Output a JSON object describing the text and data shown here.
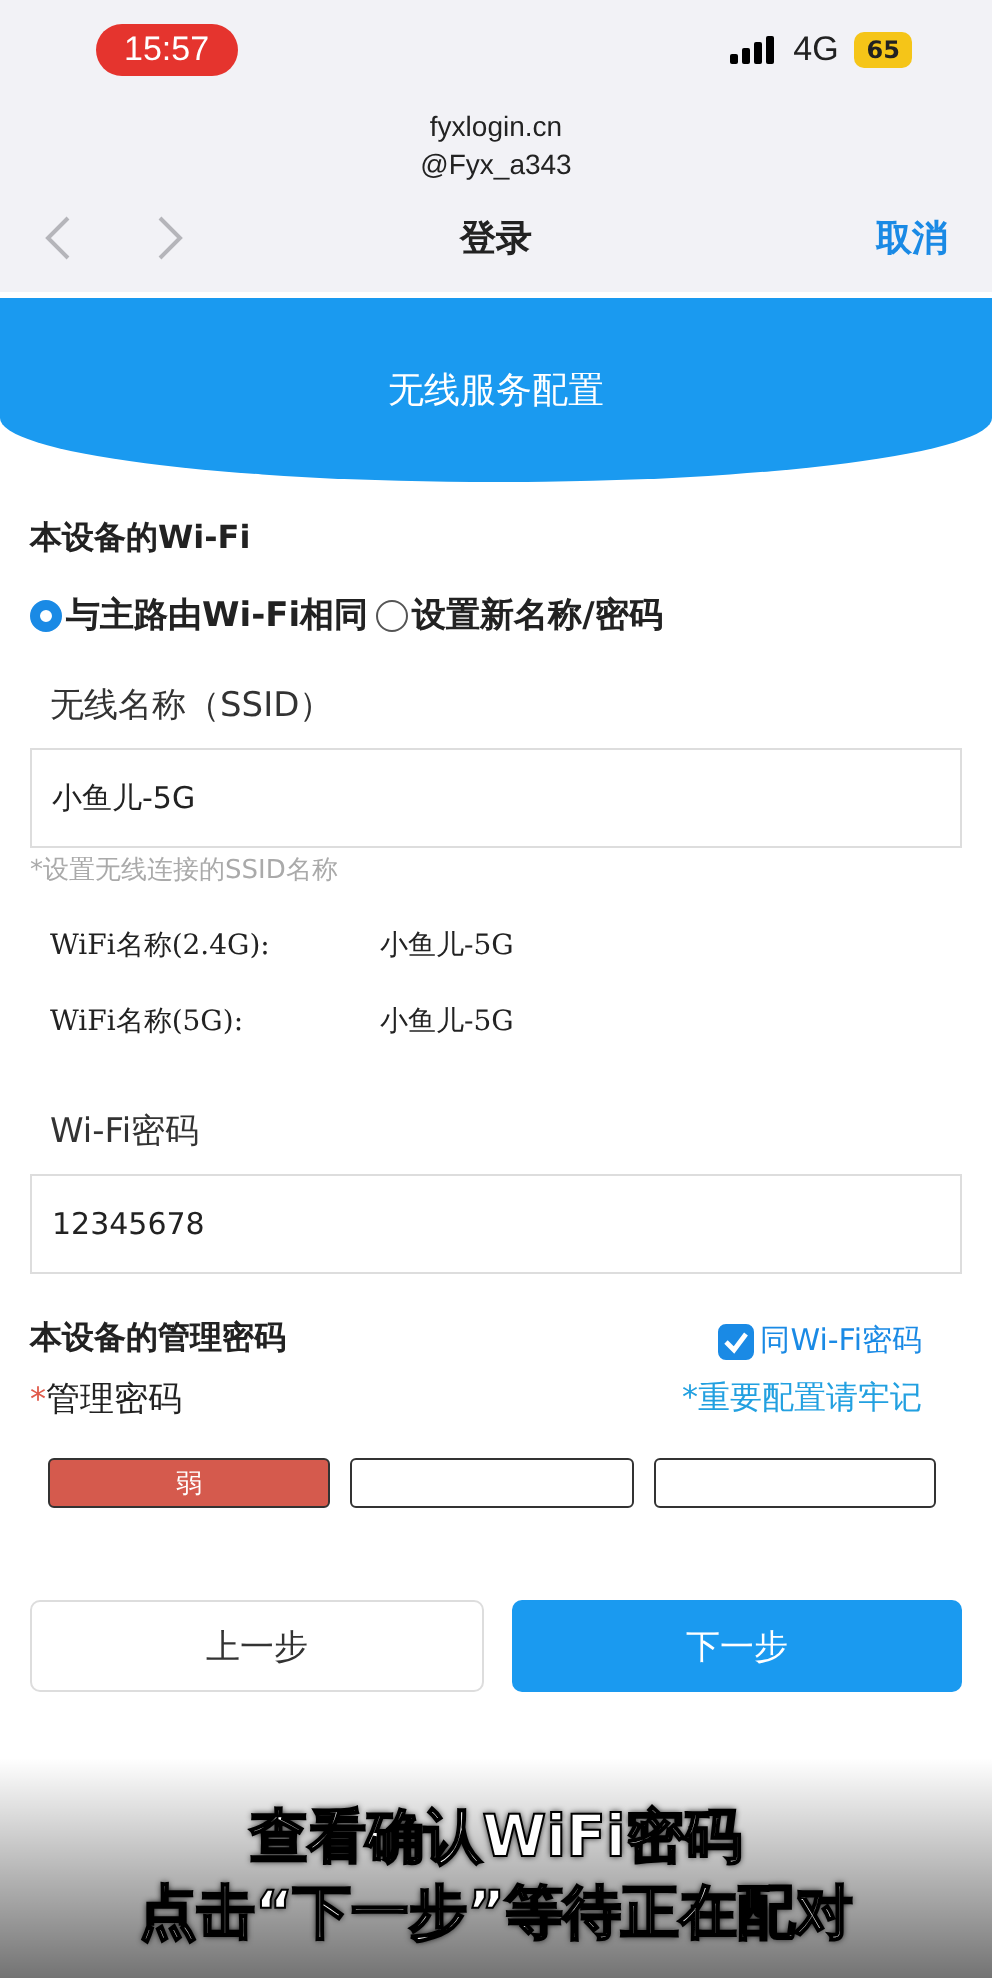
{
  "status_bar": {
    "time": "15:57",
    "network": "4G",
    "battery": "65"
  },
  "address_bar": {
    "domain": "fyxlogin.cn",
    "account": "@Fyx_a343"
  },
  "nav": {
    "title": "登录",
    "cancel": "取消"
  },
  "banner": {
    "title": "无线服务配置"
  },
  "wifi_section": {
    "title": "本设备的Wi-Fi",
    "options": [
      {
        "label": "与主路由Wi-Fi相同",
        "selected": true
      },
      {
        "label": "设置新名称/密码",
        "selected": false
      }
    ],
    "ssid_label": "无线名称（SSID）",
    "ssid_value": "小鱼儿-5G",
    "ssid_hint": "*设置无线连接的SSID名称",
    "bands": [
      {
        "label": "WiFi名称(2.4G):",
        "value": "小鱼儿-5G"
      },
      {
        "label": "WiFi名称(5G):",
        "value": "小鱼儿-5G"
      }
    ],
    "password_label": "Wi-Fi密码",
    "password_value": "12345678"
  },
  "admin_section": {
    "title": "本设备的管理密码",
    "same_as_wifi": {
      "label": "同Wi-Fi密码",
      "checked": true
    },
    "required_mark": "*",
    "password_label": "管理密码",
    "note": "*重要配置请牢记",
    "strength": [
      {
        "label": "弱",
        "on": true
      },
      {
        "on": false
      },
      {
        "on": false
      }
    ]
  },
  "buttons": {
    "back": "上一步",
    "next": "下一步"
  },
  "caption": [
    "查看确认WiFi密码",
    "点击“下一步”等待正在配对"
  ]
}
